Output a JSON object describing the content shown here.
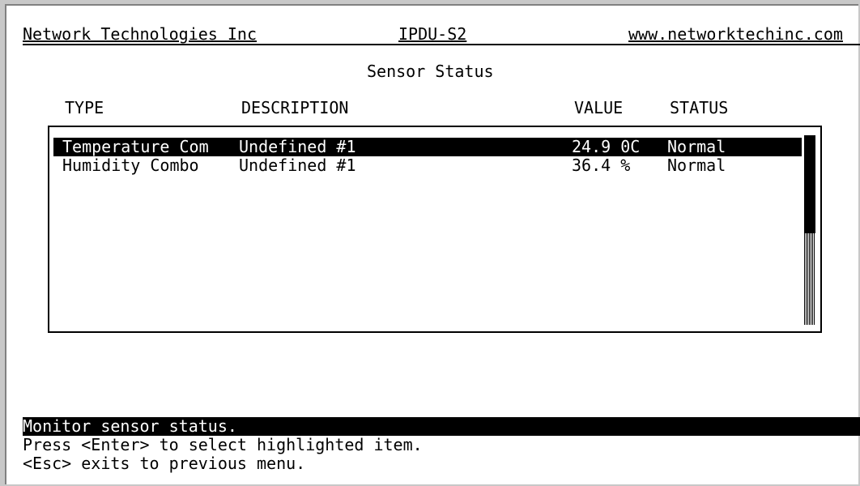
{
  "header": {
    "company": "Network Technologies Inc",
    "model": "IPDU-S2",
    "website": "www.networktechinc.com"
  },
  "page_title": "Sensor Status",
  "columns": [
    "TYPE",
    "DESCRIPTION",
    "VALUE",
    "STATUS"
  ],
  "rows": [
    {
      "type": "Temperature Com",
      "description": "Undefined #1",
      "value": "24.9 0C",
      "status": "Normal",
      "selected": true
    },
    {
      "type": "Humidity Combo",
      "description": "Undefined #1",
      "value": "36.4 %",
      "status": "Normal",
      "selected": false
    }
  ],
  "footer": {
    "status": "Monitor sensor status.",
    "hint_enter": "Press <Enter> to select highlighted item.",
    "hint_esc": "<Esc> exits to previous menu."
  }
}
